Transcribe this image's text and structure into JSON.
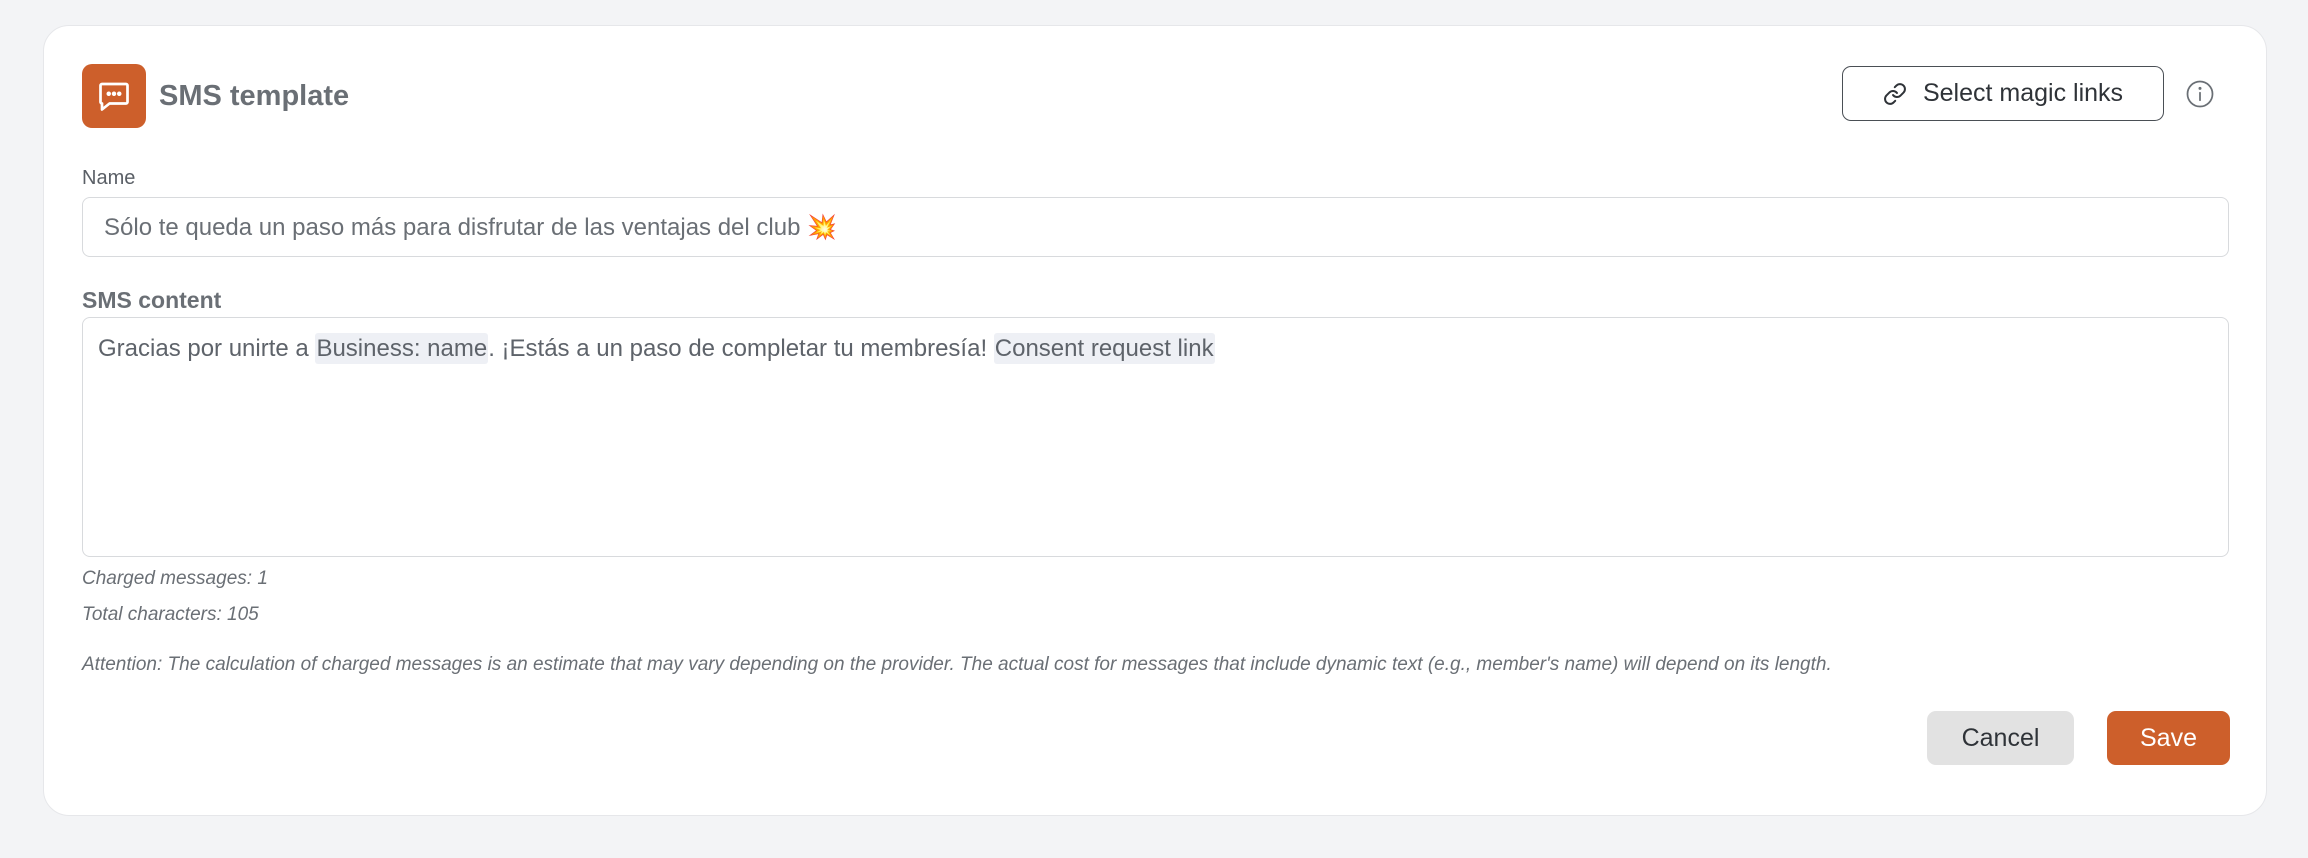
{
  "header": {
    "icon": "message-dots-icon",
    "title": "SMS template",
    "magic_links_label": "Select magic links",
    "magic_links_icon": "link-icon",
    "info_icon": "info-icon"
  },
  "form": {
    "name_label": "Name",
    "name_value": "Sólo te queda un paso más para disfrutar de las ventajas del club 💥",
    "content_label": "SMS content",
    "content": {
      "text_1": "Gracias por unirte a ",
      "chip_1": "Business: name",
      "text_2": ". ¡Estás a un paso de completar tu membresía! ",
      "chip_2": "Consent request link"
    },
    "charged_messages": "Charged messages: 1",
    "total_characters": "Total characters: 105",
    "attention": "Attention: The calculation of charged messages is an estimate that may vary depending on the provider. The actual cost for messages that include dynamic text (e.g., member's name) will depend on its length."
  },
  "actions": {
    "cancel_label": "Cancel",
    "save_label": "Save"
  },
  "colors": {
    "accent": "#cd5f2b",
    "background": "#f3f4f6",
    "chip_bg": "#eef0f5"
  }
}
